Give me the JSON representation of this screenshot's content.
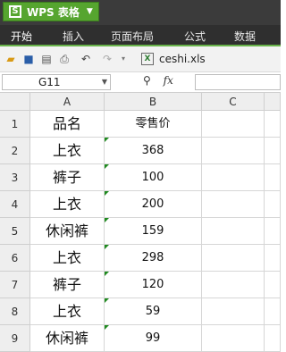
{
  "app": {
    "title": "WPS 表格",
    "logo": "S"
  },
  "menu": [
    "开始",
    "插入",
    "页面布局",
    "公式",
    "数据"
  ],
  "document": {
    "filename": "ceshi.xls"
  },
  "formula_bar": {
    "cell_ref": "G11",
    "fx_label": "fx",
    "value": ""
  },
  "sheet": {
    "columns": [
      "A",
      "B",
      "C"
    ],
    "rows": [
      {
        "num": "1",
        "a": "品名",
        "b": "零售价"
      },
      {
        "num": "2",
        "a": "上衣",
        "b": "368"
      },
      {
        "num": "3",
        "a": "裤子",
        "b": "100"
      },
      {
        "num": "4",
        "a": "上衣",
        "b": "200"
      },
      {
        "num": "5",
        "a": "休闲裤",
        "b": "159"
      },
      {
        "num": "6",
        "a": "上衣",
        "b": "298"
      },
      {
        "num": "7",
        "a": "裤子",
        "b": "120"
      },
      {
        "num": "8",
        "a": "上衣",
        "b": "59"
      },
      {
        "num": "9",
        "a": "休闲裤",
        "b": "99"
      }
    ]
  },
  "colors": {
    "accent": "#56a52f",
    "menubar": "#2f2f2f",
    "number_flag": "#1f8a1f"
  }
}
